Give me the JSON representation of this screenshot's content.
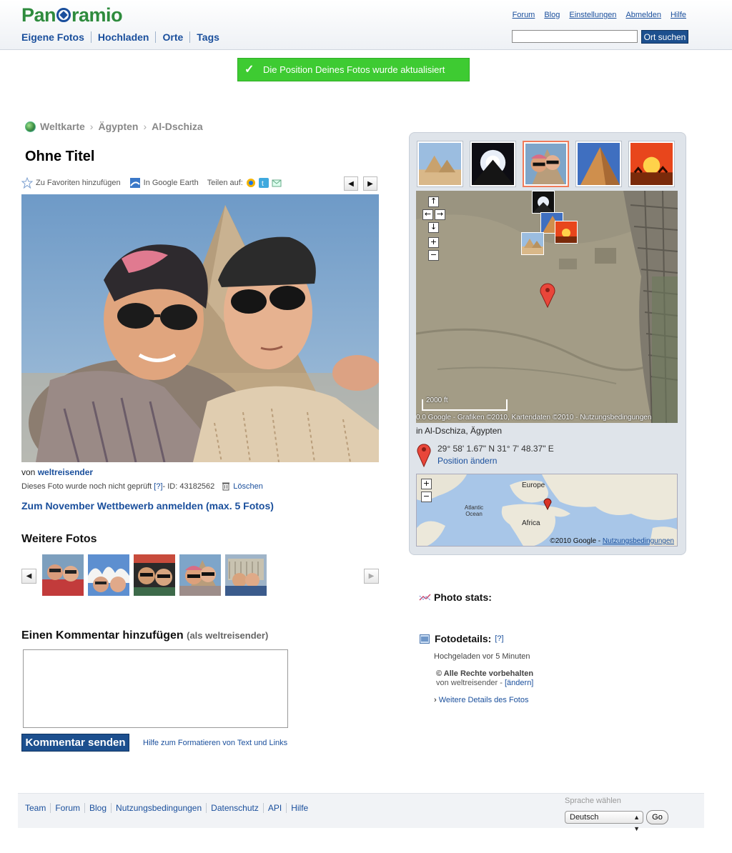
{
  "header": {
    "logo": "Panoramio",
    "nav": [
      "Eigene Fotos",
      "Hochladen",
      "Orte",
      "Tags"
    ],
    "top_links": [
      "Forum",
      "Blog",
      "Einstellungen",
      "Abmelden",
      "Hilfe"
    ],
    "search_value": "",
    "search_button": "Ort suchen"
  },
  "notice": "Die Position Deines Fotos wurde aktualisiert",
  "breadcrumb": [
    "Weltkarte",
    "Ägypten",
    "Al-Dschiza"
  ],
  "photo": {
    "title": "Ohne Titel",
    "actions": {
      "favorite": "Zu Favoriten hinzufügen",
      "earth": "In Google Earth",
      "share": "Teilen auf:"
    },
    "by_prefix": "von",
    "author": "weltreisender",
    "status": "Dieses Foto wurde noch nicht geprüft",
    "help": "[?]",
    "id_text": " - ID: 43182562",
    "delete": "Löschen",
    "contest": "Zum November Wettbewerb anmelden (max. 5 Fotos)"
  },
  "more_photos": {
    "title": "Weitere Fotos"
  },
  "comment": {
    "title": "Einen Kommentar hinzufügen",
    "as_user": "(als weltreisender)",
    "value": "",
    "submit": "Kommentar senden",
    "format_help": "Hilfe zum Formatieren von Text und Links"
  },
  "map": {
    "scale_label": "2000 ft",
    "attribution": "0.0 Google - Grafiken ©2010, Kartendaten ©2010 - Nutzungsbedingungen",
    "location": "in Al-Dschiza, Ägypten",
    "coords": "29° 58' 1.67\" N  31° 7' 48.37\" E",
    "change_position": "Position ändern",
    "world_labels": [
      "Europe",
      "Atlantic Ocean",
      "Africa"
    ],
    "world_attribution": "©2010 Google - ",
    "world_terms": "Nutzungsbedingungen"
  },
  "stats": {
    "title": "Photo stats:"
  },
  "details": {
    "title": "Fotodetails:",
    "help": "[?]",
    "uploaded": "Hochgeladen vor 5 Minuten",
    "rights": "© Alle Rechte vorbehalten",
    "by": "von weltreisender - ",
    "change": "[ändern]",
    "more": "Weitere Details des Fotos"
  },
  "footer": {
    "links": [
      "Team",
      "Forum",
      "Blog",
      "Nutzungsbedingungen",
      "Datenschutz",
      "API",
      "Hilfe"
    ],
    "lang_label": "Sprache wählen",
    "lang_value": "Deutsch",
    "go": "Go"
  },
  "colors": {
    "brand_green": "#2e8b3d",
    "link_blue": "#1a4f9c",
    "notice_green": "#3ecb32",
    "button_blue": "#1c4f8e"
  }
}
